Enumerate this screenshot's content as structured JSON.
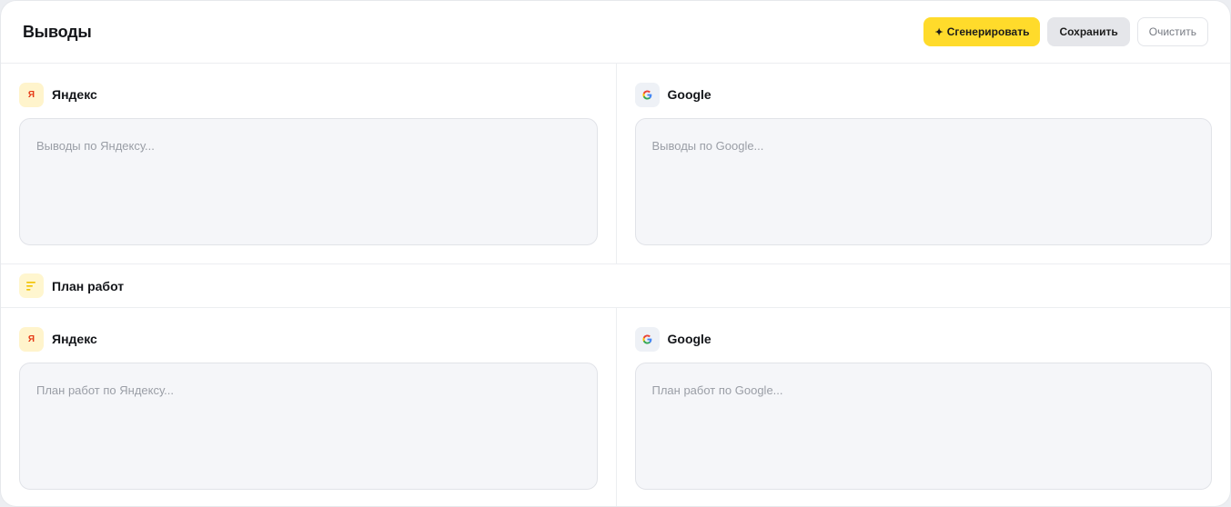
{
  "header": {
    "title": "Выводы",
    "generate_icon": "✦",
    "generate_label": "Сгенерировать",
    "save_label": "Сохранить",
    "clear_label": "Очистить"
  },
  "conclusions": {
    "yandex": {
      "badge": "Я",
      "label": "Яндекс",
      "placeholder": "Выводы по Яндексу..."
    },
    "google": {
      "badge": "G",
      "label": "Google",
      "placeholder": "Выводы по Google..."
    }
  },
  "plan": {
    "title": "План работ",
    "icon": "list-icon",
    "yandex": {
      "badge": "Я",
      "label": "Яндекс",
      "placeholder": "План работ по Яндексу..."
    },
    "google": {
      "badge": "G",
      "label": "Google",
      "placeholder": "План работ по Google..."
    }
  },
  "colors": {
    "accent": "#ffdb2b",
    "yandex_red": "#e63a16",
    "google_blue": "#4285f4",
    "google_red": "#ea4335",
    "google_yellow": "#fbbc05",
    "google_green": "#34a853"
  }
}
